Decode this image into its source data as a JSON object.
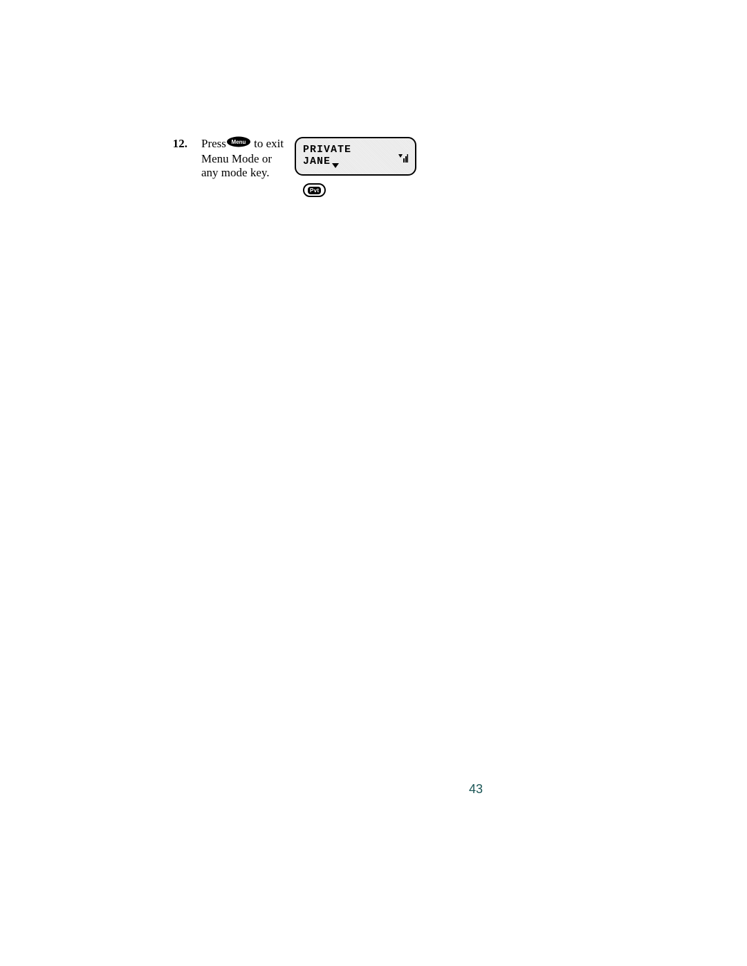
{
  "step": {
    "number": "12.",
    "text_before": "Press",
    "text_after": " to exit Menu Mode or any mode key.",
    "button_label": "Menu"
  },
  "lcd": {
    "line1": "PRIVATE",
    "line2": "JANE",
    "signal": "signal-icon",
    "down_arrow": "▼"
  },
  "badge": {
    "label": "Pvt"
  },
  "page_number": "43"
}
